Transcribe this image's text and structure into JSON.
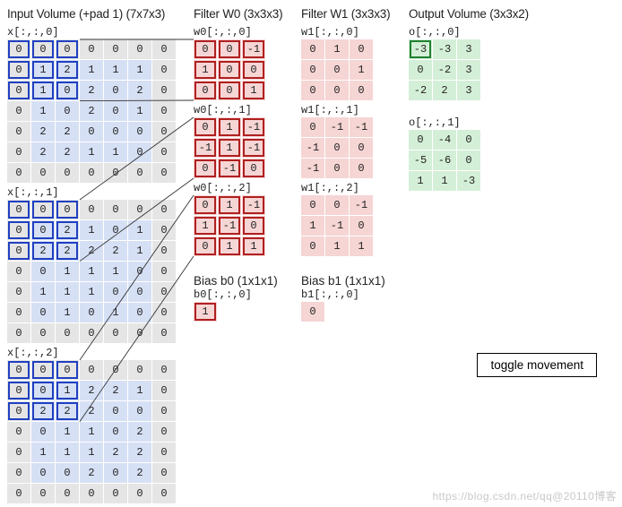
{
  "headers": {
    "input": "Input Volume (+pad 1) (7x7x3)",
    "w0": "Filter W0 (3x3x3)",
    "w1": "Filter W1 (3x3x3)",
    "output": "Output Volume (3x3x2)"
  },
  "slice_labels": {
    "x0": "x[:,:,0]",
    "x1": "x[:,:,1]",
    "x2": "x[:,:,2]",
    "w00": "w0[:,:,0]",
    "w01": "w0[:,:,1]",
    "w02": "w0[:,:,2]",
    "w10": "w1[:,:,0]",
    "w11": "w1[:,:,1]",
    "w12": "w1[:,:,2]",
    "o0": "o[:,:,0]",
    "o1": "o[:,:,1]",
    "b0h": "Bias b0 (1x1x1)",
    "b0": "b0[:,:,0]",
    "b1h": "Bias b1 (1x1x1)",
    "b1": "b1[:,:,0]"
  },
  "toggle_label": "toggle movement",
  "watermark": "https://blog.csdn.net/qq@20110博客",
  "input_hl": {
    "r0": 0,
    "c0": 0,
    "r1": 2,
    "c1": 2
  },
  "output_hl": {
    "slice": 0,
    "r": 0,
    "c": 0
  },
  "input": [
    [
      [
        0,
        0,
        0,
        0,
        0,
        0,
        0
      ],
      [
        0,
        1,
        2,
        1,
        1,
        1,
        0
      ],
      [
        0,
        1,
        0,
        2,
        0,
        2,
        0
      ],
      [
        0,
        1,
        0,
        2,
        0,
        1,
        0
      ],
      [
        0,
        2,
        2,
        0,
        0,
        0,
        0
      ],
      [
        0,
        2,
        2,
        1,
        1,
        0,
        0
      ],
      [
        0,
        0,
        0,
        0,
        0,
        0,
        0
      ]
    ],
    [
      [
        0,
        0,
        0,
        0,
        0,
        0,
        0
      ],
      [
        0,
        0,
        2,
        1,
        0,
        1,
        0
      ],
      [
        0,
        2,
        2,
        2,
        2,
        1,
        0
      ],
      [
        0,
        0,
        1,
        1,
        1,
        0,
        0
      ],
      [
        0,
        1,
        1,
        1,
        0,
        0,
        0
      ],
      [
        0,
        0,
        1,
        0,
        1,
        0,
        0
      ],
      [
        0,
        0,
        0,
        0,
        0,
        0,
        0
      ]
    ],
    [
      [
        0,
        0,
        0,
        0,
        0,
        0,
        0
      ],
      [
        0,
        0,
        1,
        2,
        2,
        1,
        0
      ],
      [
        0,
        2,
        2,
        2,
        0,
        0,
        0
      ],
      [
        0,
        0,
        1,
        1,
        0,
        2,
        0
      ],
      [
        0,
        1,
        1,
        1,
        2,
        2,
        0
      ],
      [
        0,
        0,
        0,
        2,
        0,
        2,
        0
      ],
      [
        0,
        0,
        0,
        0,
        0,
        0,
        0
      ]
    ]
  ],
  "w0": [
    [
      [
        0,
        0,
        -1
      ],
      [
        1,
        0,
        0
      ],
      [
        0,
        0,
        1
      ]
    ],
    [
      [
        0,
        1,
        -1
      ],
      [
        -1,
        1,
        -1
      ],
      [
        0,
        -1,
        0
      ]
    ],
    [
      [
        0,
        1,
        -1
      ],
      [
        1,
        -1,
        0
      ],
      [
        0,
        1,
        1
      ]
    ]
  ],
  "w1": [
    [
      [
        0,
        1,
        0
      ],
      [
        0,
        0,
        1
      ],
      [
        0,
        0,
        0
      ]
    ],
    [
      [
        0,
        -1,
        -1
      ],
      [
        -1,
        0,
        0
      ],
      [
        -1,
        0,
        0
      ]
    ],
    [
      [
        0,
        0,
        -1
      ],
      [
        1,
        -1,
        0
      ],
      [
        0,
        1,
        1
      ]
    ]
  ],
  "b0": [
    [
      1
    ]
  ],
  "b1": [
    [
      0
    ]
  ],
  "output": [
    [
      [
        -3,
        -3,
        3
      ],
      [
        0,
        -2,
        3
      ],
      [
        -2,
        2,
        3
      ]
    ],
    [
      [
        0,
        -4,
        0
      ],
      [
        -5,
        -6,
        0
      ],
      [
        1,
        1,
        -3
      ]
    ]
  ],
  "chart_data": {
    "type": "table",
    "title": "CNN convolution step (stride 2, pad 1)",
    "input_shape": [
      7,
      7,
      3
    ],
    "filter_shape": [
      3,
      3,
      3
    ],
    "output_shape": [
      3,
      3,
      2
    ]
  }
}
